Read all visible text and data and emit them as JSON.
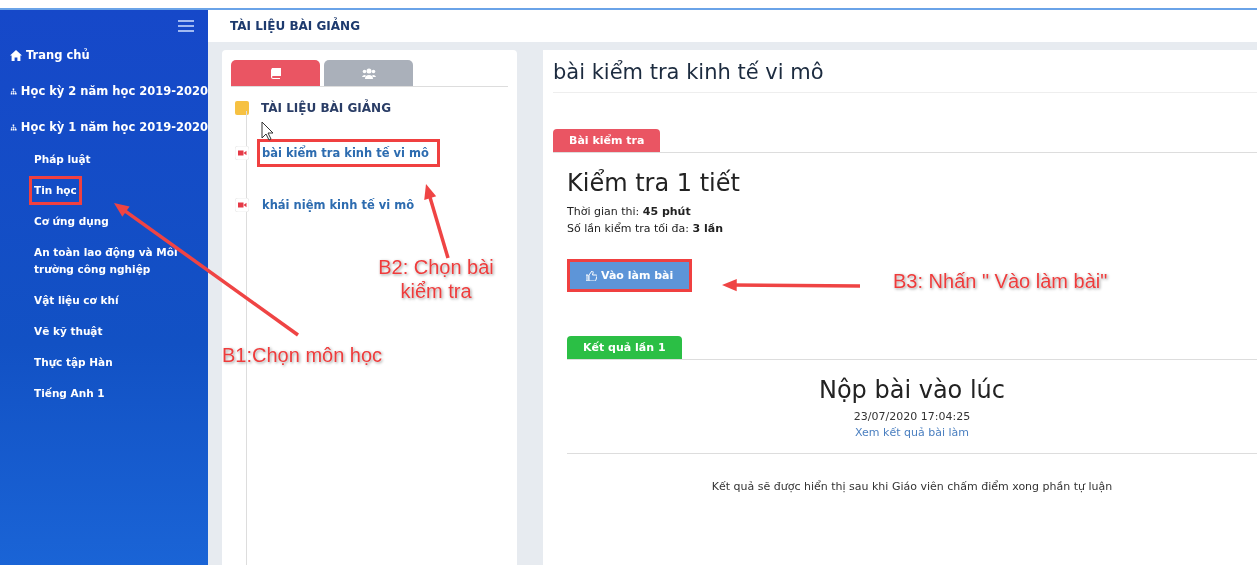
{
  "sidebar": {
    "items": [
      {
        "label": "Trang chủ",
        "kind": "home"
      },
      {
        "label": "Học kỳ 2 năm học 2019-2020",
        "kind": "group"
      },
      {
        "label": "Học kỳ 1 năm học 2019-2020",
        "kind": "group",
        "children": [
          {
            "label": "Pháp luật",
            "highlighted": false
          },
          {
            "label": "Tin học",
            "highlighted": true
          },
          {
            "label": "Cơ ứng dụng",
            "highlighted": false
          },
          {
            "label": "An toàn lao động và Môi trường công nghiệp",
            "highlighted": false
          },
          {
            "label": "Vật liệu cơ khí",
            "highlighted": false
          },
          {
            "label": "Vẽ kỹ thuật",
            "highlighted": false
          },
          {
            "label": "Thực tập Hàn",
            "highlighted": false
          },
          {
            "label": "Tiếng Anh 1",
            "highlighted": false
          }
        ]
      }
    ]
  },
  "header": {
    "title": "TÀI LIỆU BÀI GIẢNG"
  },
  "materials": {
    "tabs": [
      {
        "kind": "book",
        "selected": true
      },
      {
        "kind": "users",
        "selected": false
      }
    ],
    "section": "TÀI LIỆU BÀI GIẢNG",
    "lessons": [
      {
        "label": "bài kiểm tra kinh tế vi mô",
        "highlighted": true
      },
      {
        "label": "khái niệm kinh tế vi mô",
        "highlighted": false
      }
    ]
  },
  "content": {
    "title": "bài kiểm tra kinh tế vi mô",
    "exam_tab": "Bài kiểm tra",
    "exam_title": "Kiểm tra 1 tiết",
    "info": [
      "Thời gian thi: **45 phút**",
      "Số lần kiểm tra tối đa: **3 lần**"
    ],
    "start_button": {
      "label": "Vào làm bài",
      "highlighted": true
    },
    "result_tab": "Kết quả lần 1",
    "submitted_heading": "Nộp bài vào lúc",
    "submitted_time": "23/07/2020 17:04:25",
    "view_result_link": "Xem kết quả bài làm",
    "note": "Kết quả sẽ được hiển thị sau khi Giáo viên chấm điểm xong phần tự luận"
  },
  "annotations": [
    {
      "text": "B1:Chọn môn học"
    },
    {
      "text": "B2: Chọn bài kiểm tra"
    },
    {
      "text": "B3: Nhấn \" Vào làm bài\""
    }
  ]
}
